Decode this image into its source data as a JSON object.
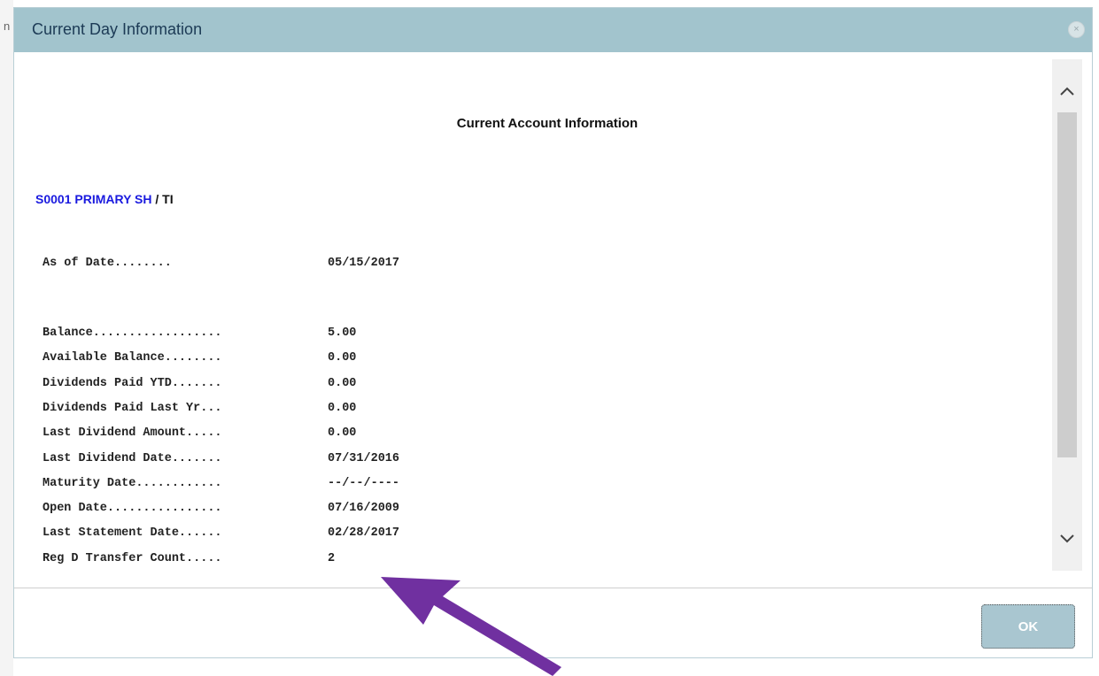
{
  "background": {
    "left_fragment": "n"
  },
  "dialog": {
    "title": "Current Day Information",
    "close_label": "×",
    "heading": "Current Account Information",
    "account": {
      "link_text": "S0001 PRIMARY SH",
      "suffix": " / TI"
    },
    "as_of": {
      "label": "As of Date........",
      "value": "05/15/2017"
    },
    "rows": [
      {
        "label": "Balance..................",
        "value": "5.00"
      },
      {
        "label": "Available Balance........",
        "value": "0.00"
      },
      {
        "label": "Dividends Paid YTD.......",
        "value": "0.00"
      },
      {
        "label": "Dividends Paid Last Yr...",
        "value": "0.00"
      },
      {
        "label": "Last Dividend Amount.....",
        "value": "0.00"
      },
      {
        "label": "Last Dividend Date.......",
        "value": "07/31/2016"
      },
      {
        "label": "Maturity Date............",
        "value": "--/--/----"
      },
      {
        "label": "Open Date................",
        "value": "07/16/2009"
      },
      {
        "label": "Last Statement Date......",
        "value": "02/28/2017"
      },
      {
        "label": "Reg D Transfer Count.....",
        "value": "2"
      }
    ],
    "ok_label": "OK"
  },
  "colors": {
    "titlebar": "#a2c4cd",
    "link": "#1a1adf",
    "ok_button": "#a9c6d0",
    "annotation_arrow": "#7030a0"
  },
  "icons": {
    "close": "close-icon",
    "scroll_up": "chevron-up-icon",
    "scroll_down": "chevron-down-icon",
    "annotation": "arrow-icon"
  }
}
